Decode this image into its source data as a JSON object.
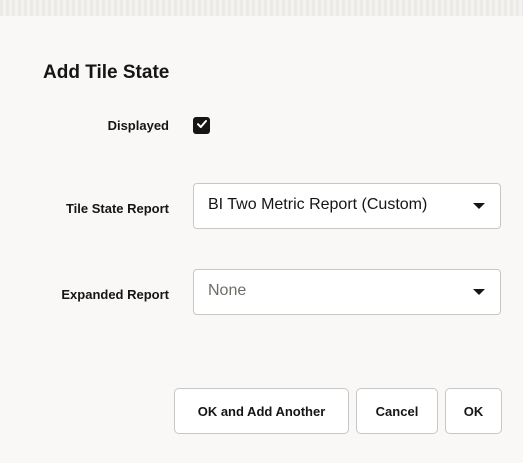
{
  "dialog": {
    "title": "Add Tile State"
  },
  "form": {
    "displayed": {
      "label": "Displayed",
      "checked": true
    },
    "tile_state_report": {
      "label": "Tile State Report",
      "value": "BI Two Metric Report (Custom)"
    },
    "expanded_report": {
      "label": "Expanded Report",
      "value": "None"
    }
  },
  "buttons": {
    "ok_add_another": "OK and Add Another",
    "cancel": "Cancel",
    "ok": "OK"
  },
  "icons": {
    "checkbox": "checkmark-icon",
    "dropdown": "chevron-down-icon"
  }
}
